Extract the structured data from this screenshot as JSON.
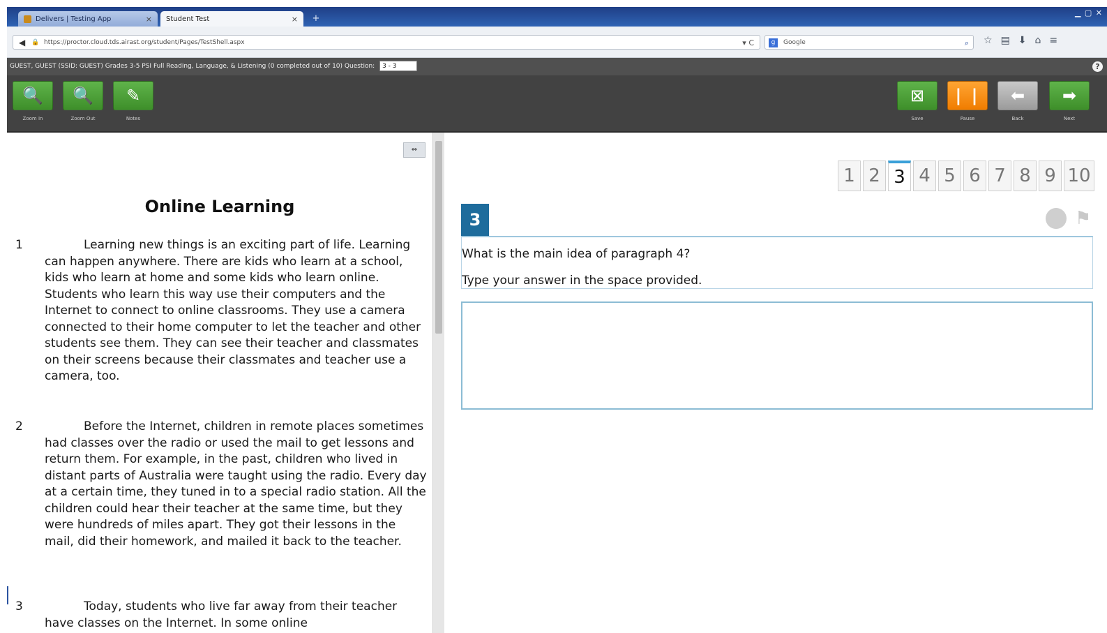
{
  "browser": {
    "tabs": [
      {
        "label": "Delivers | Testing App",
        "active": false
      },
      {
        "label": "Student Test",
        "active": true
      }
    ],
    "new_tab_label": "+",
    "url": "https://proctor.cloud.tds.airast.org/student/Pages/TestShell.aspx",
    "search_placeholder": "Google"
  },
  "infobar": {
    "text": "GUEST, GUEST (SSID: GUEST)  Grades 3-5 PSI Full Reading, Language, & Listening (0 completed out of 10)",
    "question_label": "Question:",
    "question_select": "3 - 3",
    "help_label": "?"
  },
  "toolbar": {
    "left": [
      {
        "label": "Zoom In",
        "icon": "magnifier-plus-icon",
        "glyph": "🔍"
      },
      {
        "label": "Zoom Out",
        "icon": "magnifier-minus-icon",
        "glyph": "🔍"
      },
      {
        "label": "Notes",
        "icon": "notepad-pencil-icon",
        "glyph": "✎"
      }
    ],
    "right": [
      {
        "label": "Save",
        "icon": "save-icon",
        "glyph": "⊠"
      },
      {
        "label": "Pause",
        "icon": "pause-icon",
        "glyph": "| |"
      },
      {
        "label": "Back",
        "icon": "arrow-left-icon",
        "glyph": "⬅"
      },
      {
        "label": "Next",
        "icon": "arrow-right-icon",
        "glyph": "➡"
      }
    ]
  },
  "passage": {
    "collapse_label": "⇔",
    "title": "Online Learning",
    "paragraphs": [
      {
        "num": "1",
        "text": "Learning new things is an exciting part of life. Learning can happen anywhere. There are kids who learn at a school, kids who learn at home and some kids who learn online. Students who learn this way use their computers and the Internet to connect to online classrooms. They use a camera connected to their home computer to let the teacher and other students see them. They can see their teacher and classmates on their screens because their classmates and teacher use a camera, too."
      },
      {
        "num": "2",
        "text": "Before the Internet, children in remote places sometimes had classes over the radio or used the mail to get lessons and return them. For example, in the past, children who lived in distant parts of Australia were taught using the radio. Every day at a certain time, they tuned in to a special radio station. All the children could hear their teacher at the same time, but they were hundreds of miles apart. They got their lessons in the mail, did their homework, and mailed it back to the teacher."
      },
      {
        "num": "3",
        "text": "Today, students who live far away from their teacher have classes on the Internet. In some online"
      }
    ]
  },
  "question": {
    "numbers": [
      "1",
      "2",
      "3",
      "4",
      "5",
      "6",
      "7",
      "8",
      "9",
      "10"
    ],
    "current": "3",
    "badge": "3",
    "prompt": "What is the main idea of paragraph 4?",
    "instruction": "Type your answer in the space provided.",
    "answer_value": ""
  }
}
